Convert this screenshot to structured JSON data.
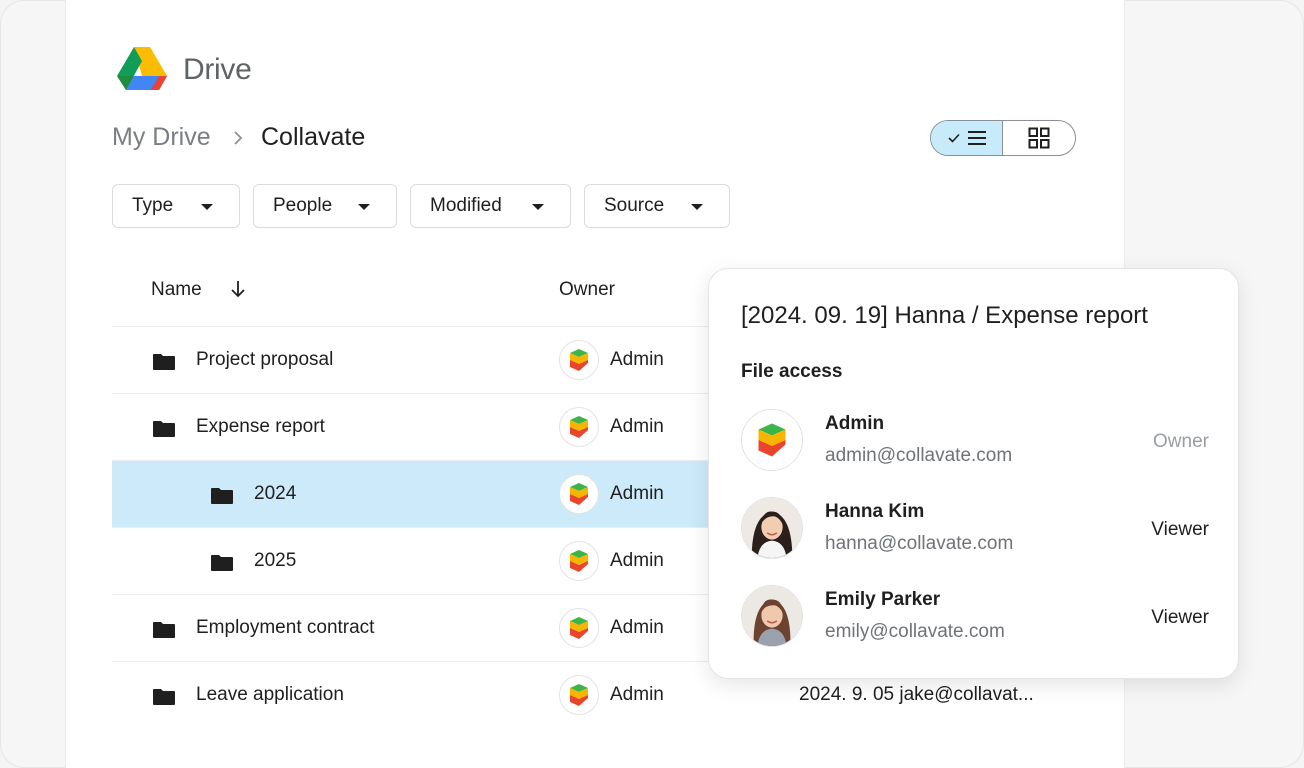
{
  "app": {
    "brand": "Drive"
  },
  "breadcrumb": {
    "root": "My Drive",
    "current": "Collavate"
  },
  "filters": [
    {
      "label": "Type"
    },
    {
      "label": "People"
    },
    {
      "label": "Modified"
    },
    {
      "label": "Source"
    }
  ],
  "view_toggle": {
    "selected": "list"
  },
  "table": {
    "headers": {
      "name": "Name",
      "owner": "Owner"
    },
    "rows": [
      {
        "name": "Project proposal",
        "owner": "Admin",
        "modified": ""
      },
      {
        "name": "Expense report",
        "owner": "Admin",
        "modified": ""
      },
      {
        "name": "2024",
        "owner": "Admin",
        "modified": "",
        "selected": true
      },
      {
        "name": "2025",
        "owner": "Admin",
        "modified": ""
      },
      {
        "name": "Employment contract",
        "owner": "Admin",
        "modified": ""
      },
      {
        "name": "Leave application",
        "owner": "Admin",
        "modified": "2024. 9. 05  jake@collavat..."
      }
    ]
  },
  "popup": {
    "title": "[2024. 09. 19] Hanna / Expense report",
    "section": "File access",
    "people": [
      {
        "name": "Admin",
        "email": "admin@collavate.com",
        "role": "Owner"
      },
      {
        "name": "Hanna Kim",
        "email": "hanna@collavate.com",
        "role": "Viewer"
      },
      {
        "name": "Emily Parker",
        "email": "emily@collavate.com",
        "role": "Viewer"
      }
    ]
  },
  "colors": {
    "selected_row": "#cdeafb",
    "toggle_active": "#c8ebfb"
  }
}
